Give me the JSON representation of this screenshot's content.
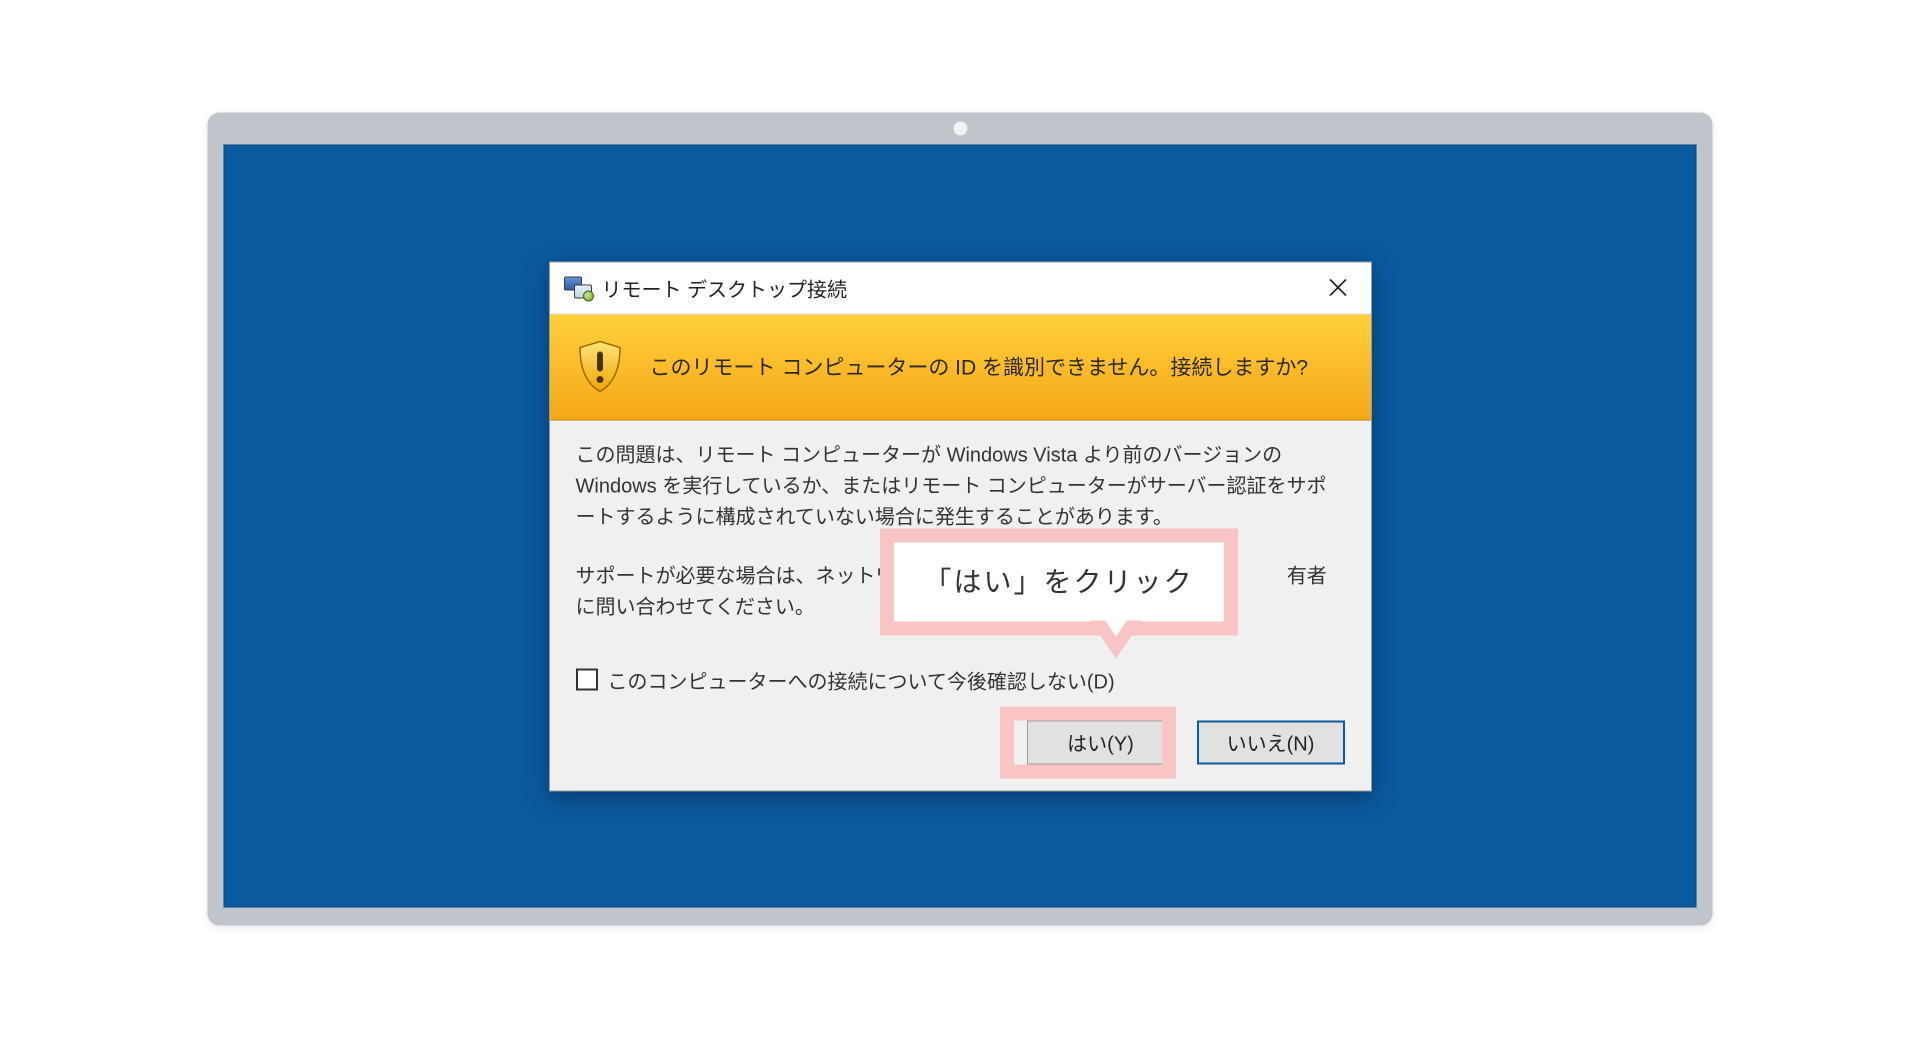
{
  "dialog": {
    "title": "リモート デスクトップ接続",
    "warning_heading": "このリモート コンピューターの ID を識別できません。接続しますか?",
    "body_paragraph_1": "この問題は、リモート コンピューターが Windows Vista より前のバージョンの Windows を実行しているか、またはリモート コンピューターがサーバー認証をサポートするように構成されていない場合に発生することがあります。",
    "body_paragraph_2_pre": "サポートが必要な場合は、ネットワー",
    "body_paragraph_2_post": "有者に問い合わせてください。",
    "checkbox_label": "このコンピューターへの接続について今後確認しない(D)",
    "checkbox_checked": false,
    "buttons": {
      "yes": "はい(Y)",
      "no": "いいえ(N)"
    }
  },
  "annotation": {
    "callout_text": "「はい」をクリック"
  }
}
